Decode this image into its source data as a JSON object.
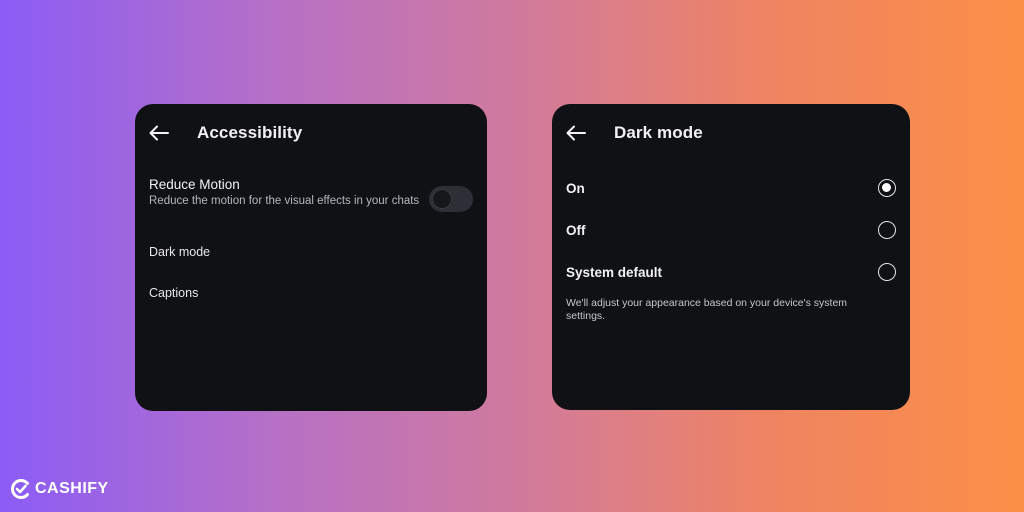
{
  "accessibility_panel": {
    "title": "Accessibility",
    "back_icon": "arrow-left-icon",
    "reduce_motion": {
      "label": "Reduce Motion",
      "description": "Reduce the motion for the visual effects in your chats",
      "enabled": false
    },
    "items": [
      {
        "label": "Dark mode"
      },
      {
        "label": "Captions"
      }
    ]
  },
  "dark_mode_panel": {
    "title": "Dark mode",
    "back_icon": "arrow-left-icon",
    "options": [
      {
        "label": "On",
        "selected": true
      },
      {
        "label": "Off",
        "selected": false
      },
      {
        "label": "System default",
        "selected": false
      }
    ],
    "note": "We'll adjust your appearance based on your device's system settings."
  },
  "branding": {
    "logo_text": "CASHIFY",
    "logo_icon": "cashify-logo-icon"
  },
  "colors": {
    "panel_background": "#0f1115",
    "gradient_start": "#8b5cf6",
    "gradient_end": "#fc8f47",
    "text_primary": "#f2f2f4",
    "text_secondary": "#b5b7bd"
  }
}
